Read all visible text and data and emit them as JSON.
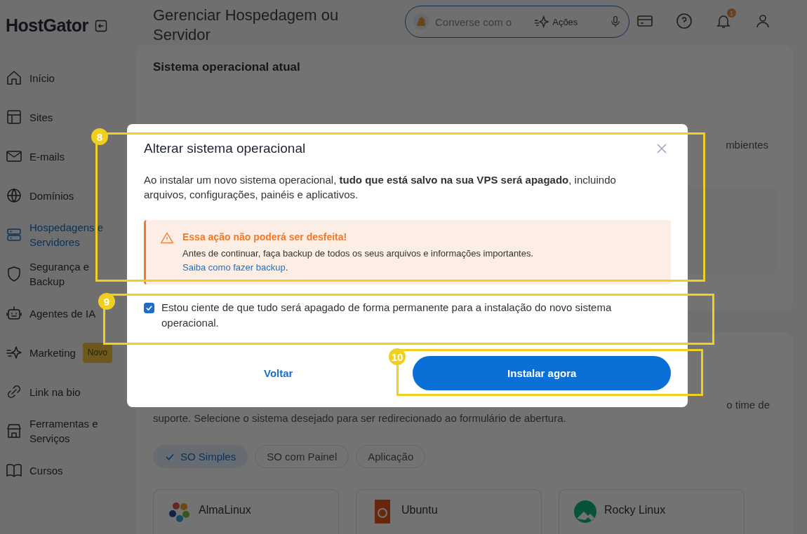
{
  "sidebar": {
    "logo": "HostGator",
    "items": [
      {
        "label": "Início",
        "selected": false
      },
      {
        "label": "Sites",
        "selected": false
      },
      {
        "label": "E-mails",
        "selected": false
      },
      {
        "label": "Domínios",
        "selected": false
      },
      {
        "label": "Hospedagens e Servidores",
        "selected": true
      },
      {
        "label": "Segurança e Backup",
        "selected": false
      },
      {
        "label": "Agentes de IA",
        "selected": false
      },
      {
        "label": "Marketing",
        "selected": false,
        "badge": "Novo"
      },
      {
        "label": "Link na bio",
        "selected": false
      },
      {
        "label": "Ferramentas e Serviços",
        "selected": false
      },
      {
        "label": "Cursos",
        "selected": false
      }
    ]
  },
  "header": {
    "title": "Gerenciar Hospedagem ou Servidor",
    "assistant_placeholder": "Converse com o",
    "actions": "Ações",
    "notification_count": "1"
  },
  "current_os": {
    "heading": "Sistema operacional atual",
    "text_fragment": "mbientes"
  },
  "catalog": {
    "intro_line_end": "o time de",
    "intro_line": "suporte. Selecione o sistema desejado para ser redirecionado ao formulário de abertura.",
    "filters": [
      {
        "label": "SO Simples",
        "selected": true
      },
      {
        "label": "SO com Painel",
        "selected": false
      },
      {
        "label": "Aplicação",
        "selected": false
      }
    ],
    "os_cards": [
      {
        "name": "AlmaLinux"
      },
      {
        "name": "Ubuntu"
      },
      {
        "name": "Rocky Linux"
      }
    ]
  },
  "modal": {
    "title": "Alterar sistema operacional",
    "body": "Ao instalar um novo sistema operacional, **tudo que está salvo na sua VPS será apagado**, incluindo arquivos, configurações, painéis e aplicativos.",
    "alert": {
      "title": "Essa ação não poderá ser desfeita!",
      "text": "Antes de continuar, faça backup de todos os seus arquivos e informações importantes.",
      "link": "Saiba como fazer backup",
      "link_end": "."
    },
    "confirm": {
      "label": "Estou ciente de que tudo será apagado de forma permanente para a instalação do novo sistema operacional.",
      "checked": true
    },
    "back_button": "Voltar",
    "primary_button": "Instalar agora"
  },
  "annotations": [
    {
      "number": "8"
    },
    {
      "number": "9"
    },
    {
      "number": "10"
    }
  ]
}
